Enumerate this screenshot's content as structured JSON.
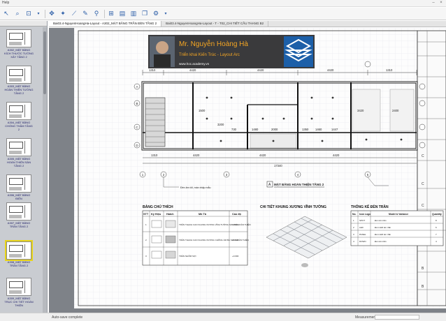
{
  "window": {
    "title": "Help"
  },
  "toolbar": {
    "icons": [
      "select-icon",
      "zoom-icon",
      "zoom-area-icon",
      "zoom-dropdown-icon",
      "pan-icon",
      "snap-icon",
      "link-icon",
      "markup-icon",
      "tag-icon",
      "stamp-icon",
      "page-icon",
      "doc-icon",
      "copy-icon",
      "settings-icon"
    ]
  },
  "sidebar": {
    "thumbs": [
      {
        "label": "A302_MẶT BẰNG KÍCH THƯỚC TƯỜNG XÂY TẦNG 2"
      },
      {
        "label": "A303_MẶT BẰNG HOÀN THIỆN TƯỜNG TẦNG 2"
      },
      {
        "label": "A304_MẶT BẰNG CHỐNG THẤM TẦNG 2"
      },
      {
        "label": "A305_MẶT BẰNG HOÀN THIỆN SÀN TẦNG 2"
      },
      {
        "label": "A306_MẶT BẰNG ĐIỆN"
      },
      {
        "label": "A307_MẶT BẰNG TRẦN TẦNG 2"
      },
      {
        "label": "A308_MẶT BẰNG TRẦN TẦNG 2"
      },
      {
        "label": "A309_MẶT BẰNG TRỤC CHI TIẾT HOÀN THIỆN"
      }
    ]
  },
  "tabs": [
    {
      "label": "Bai03.4-NguyenHoangHa-Layout - A302_MẶT BẰNG TRẦN ĐÈN TẦNG 2"
    },
    {
      "label": "Bai03.4-NguyenHoangHa-Layout - T - T02_CHI TIẾT CẦU THANG B2"
    }
  ],
  "banner": {
    "name": "Mr. Nguyễn Hoàng Hà",
    "subtitle": "Triển khai Kiến Trúc - Layout Arc",
    "website": "www.hoc.academy.vn"
  },
  "plan": {
    "dims_top": [
      "1310",
      "4420",
      "4420",
      "4420",
      "1310"
    ],
    "dims_bottom": [
      "1310",
      "4420",
      "4420",
      "4420"
    ],
    "overall": "17340",
    "inner": [
      "1500",
      "3200",
      "1480",
      "2000",
      "1350",
      "1460",
      "3420",
      "1447",
      "730",
      "2400"
    ],
    "grid_letters": [
      "A",
      "B",
      "C",
      "D"
    ],
    "grid_numbers": [
      "1",
      "2",
      "3",
      "4",
      "5"
    ],
    "title_tag": "A",
    "title": "MẶT BẰNG HOÀN THIỆN TẦNG 2",
    "notes": [
      "Đèn âm tốt, màn nhập mẫu"
    ]
  },
  "legend": {
    "title": "BẢNG CHÚ THÍCH",
    "headers": [
      "STT",
      "Ký Hiệu",
      "Hatch",
      "Mô Tả",
      "Cao độ"
    ],
    "rows": [
      {
        "stt": "1",
        "desc": "TRẦN THẠCH CAO KHUNG XƯƠNG VĨNH TƯỜNG SƠN BẢ HOÀN THIỆN",
        "level": "+3.000"
      },
      {
        "stt": "2",
        "desc": "TRẦN THẠCH CAO KHUNG XƯƠNG CHỐNG ẨM BẢ SƠN HOÀN THIỆN",
        "level": "+3.000"
      },
      {
        "stt": "3",
        "desc": "TRẦN NHÔM SỢI",
        "level": "+3.000"
      }
    ]
  },
  "detail": {
    "title": "CHI TIẾT KHUNG XƯƠNG VĨNH TƯỜNG"
  },
  "stats": {
    "title": "THỐNG KÊ ĐÈN TRẦN",
    "headers": [
      "No.",
      "Icon Logo",
      "Model & Variance",
      "Quantity"
    ],
    "rows": [
      {
        "no": "1",
        "code": "SPOT",
        "model": "Đèn âm trần",
        "qty": "8"
      },
      {
        "no": "2",
        "code": "LED",
        "model": "Đèn LED âm trần",
        "qty": "6"
      },
      {
        "no": "3",
        "code": "PANEL",
        "model": "Đèn LED âm trần",
        "qty": "7"
      },
      {
        "no": "4",
        "code": "DOWN",
        "model": "Đèn âm trần",
        "qty": "4"
      }
    ]
  },
  "status": {
    "left": "Auto-save complete",
    "measurement_label": "Measurements"
  }
}
